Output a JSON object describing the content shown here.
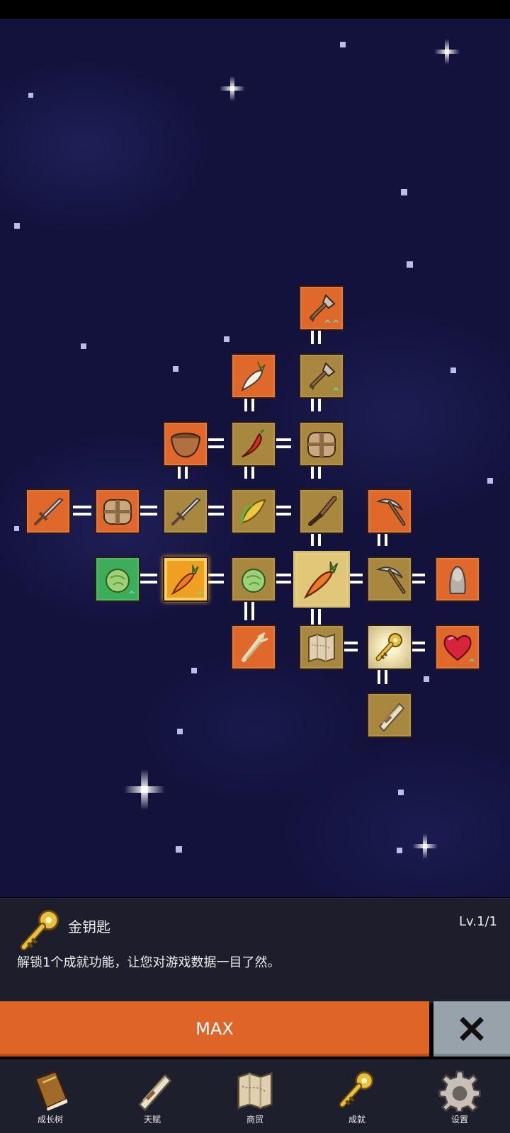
{
  "skill_tree": {
    "nodes": [
      {
        "id": "shovel-2",
        "icon": "shovel-icon",
        "style": "orange",
        "upgrade": true
      },
      {
        "id": "radish",
        "icon": "radish-icon",
        "style": "orange",
        "upgrade": false
      },
      {
        "id": "shovel-1",
        "icon": "shovel-icon",
        "style": "gold",
        "upgrade": true
      },
      {
        "id": "bowl",
        "icon": "bowl-icon",
        "style": "orange",
        "upgrade": false
      },
      {
        "id": "chili",
        "icon": "chili-pepper-icon",
        "style": "gold",
        "upgrade": false
      },
      {
        "id": "chest-2",
        "icon": "treasure-chest-icon",
        "style": "gold",
        "upgrade": false
      },
      {
        "id": "sword-2",
        "icon": "sword-icon",
        "style": "orange",
        "upgrade": false
      },
      {
        "id": "chest-1",
        "icon": "treasure-chest-icon",
        "style": "orange",
        "upgrade": false
      },
      {
        "id": "sword-1",
        "icon": "sword-icon",
        "style": "gold",
        "upgrade": false
      },
      {
        "id": "corn",
        "icon": "corn-icon",
        "style": "gold",
        "upgrade": false
      },
      {
        "id": "dagger",
        "icon": "dagger-icon",
        "style": "gold",
        "upgrade": false
      },
      {
        "id": "pickaxe-2",
        "icon": "pickaxe-icon",
        "style": "orange",
        "upgrade": false
      },
      {
        "id": "cabbage-2",
        "icon": "cabbage-icon",
        "style": "green",
        "upgrade": true
      },
      {
        "id": "carrot-2",
        "icon": "carrot-icon",
        "style": "glow",
        "upgrade": true
      },
      {
        "id": "cabbage-1",
        "icon": "cabbage-icon",
        "style": "gold",
        "upgrade": false
      },
      {
        "id": "carrot-root",
        "icon": "carrot-icon",
        "style": "selected",
        "upgrade": false
      },
      {
        "id": "pickaxe-1",
        "icon": "pickaxe-icon",
        "style": "gold",
        "upgrade": false
      },
      {
        "id": "statue",
        "icon": "statue-icon",
        "style": "orange",
        "upgrade": false
      },
      {
        "id": "wheat",
        "icon": "wheat-icon",
        "style": "orange",
        "upgrade": false
      },
      {
        "id": "map",
        "icon": "map-icon",
        "style": "gold",
        "upgrade": false
      },
      {
        "id": "gold-key",
        "icon": "key-icon",
        "style": "radiant",
        "upgrade": false
      },
      {
        "id": "heart",
        "icon": "heart-icon",
        "style": "orange",
        "upgrade": true
      },
      {
        "id": "scroll",
        "icon": "scroll-icon",
        "style": "gold",
        "upgrade": false
      }
    ]
  },
  "detail_panel": {
    "icon": "key-icon",
    "name": "金钥匙",
    "level": "Lv.1/1",
    "description": "解锁1个成就功能，让您对游戏数据一目了然。"
  },
  "actions": {
    "max_label": "MAX",
    "close_icon": "close-icon"
  },
  "bottom_nav": [
    {
      "label": "成长树",
      "icon": "book-icon"
    },
    {
      "label": "天赋",
      "icon": "scroll-icon"
    },
    {
      "label": "商贸",
      "icon": "map-icon"
    },
    {
      "label": "成就",
      "icon": "key-icon"
    },
    {
      "label": "设置",
      "icon": "gear-icon"
    }
  ],
  "colors": {
    "background": "#13123c",
    "node_orange": "#e0682a",
    "node_gold": "#a8873e",
    "node_green": "#3cae5a",
    "button_orange": "#de6428",
    "close_button": "#98a2ab",
    "panel": "#1d1d2c"
  }
}
